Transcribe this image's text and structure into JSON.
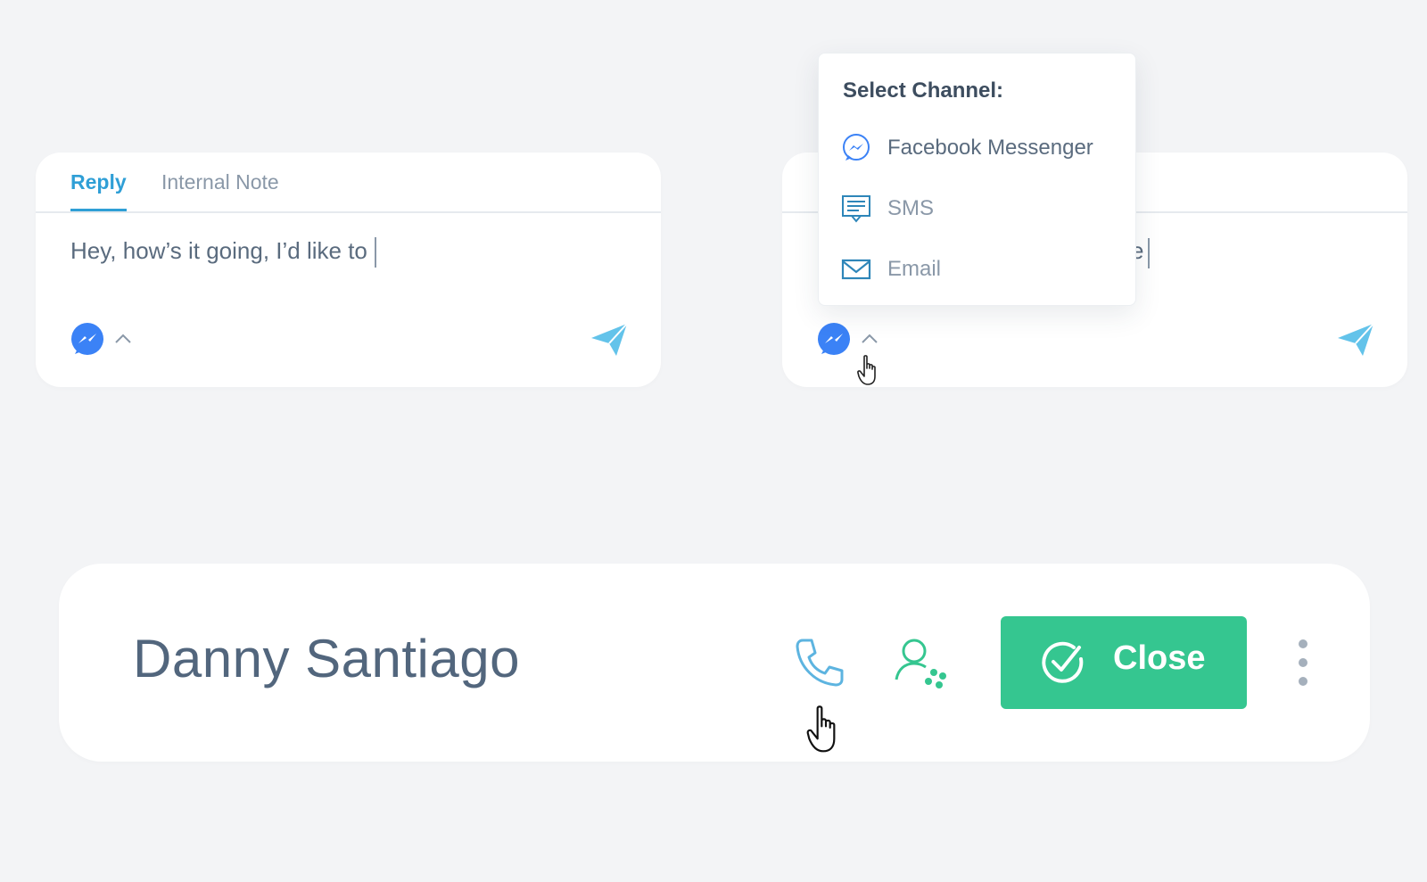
{
  "reply_composer": {
    "tabs": [
      {
        "label": "Reply"
      },
      {
        "label": "Internal Note"
      }
    ],
    "draft_text": "Hey, how’s it going, I’d like to"
  },
  "reply_composer_2": {
    "draft_tail": "e"
  },
  "channel_dropdown": {
    "title": "Select Channel:",
    "items": [
      {
        "label": "Facebook Messenger",
        "icon": "messenger-icon"
      },
      {
        "label": "SMS",
        "icon": "sms-icon"
      },
      {
        "label": "Email",
        "icon": "email-icon"
      }
    ]
  },
  "contact_header": {
    "name": "Danny Santiago",
    "close_label": "Close"
  },
  "colors": {
    "accent_blue": "#2f9fd6",
    "messenger_blue": "#3b82f6",
    "send_blue": "#63c3ea",
    "success_green": "#35c690",
    "text_gray": "#5a6b7e"
  }
}
